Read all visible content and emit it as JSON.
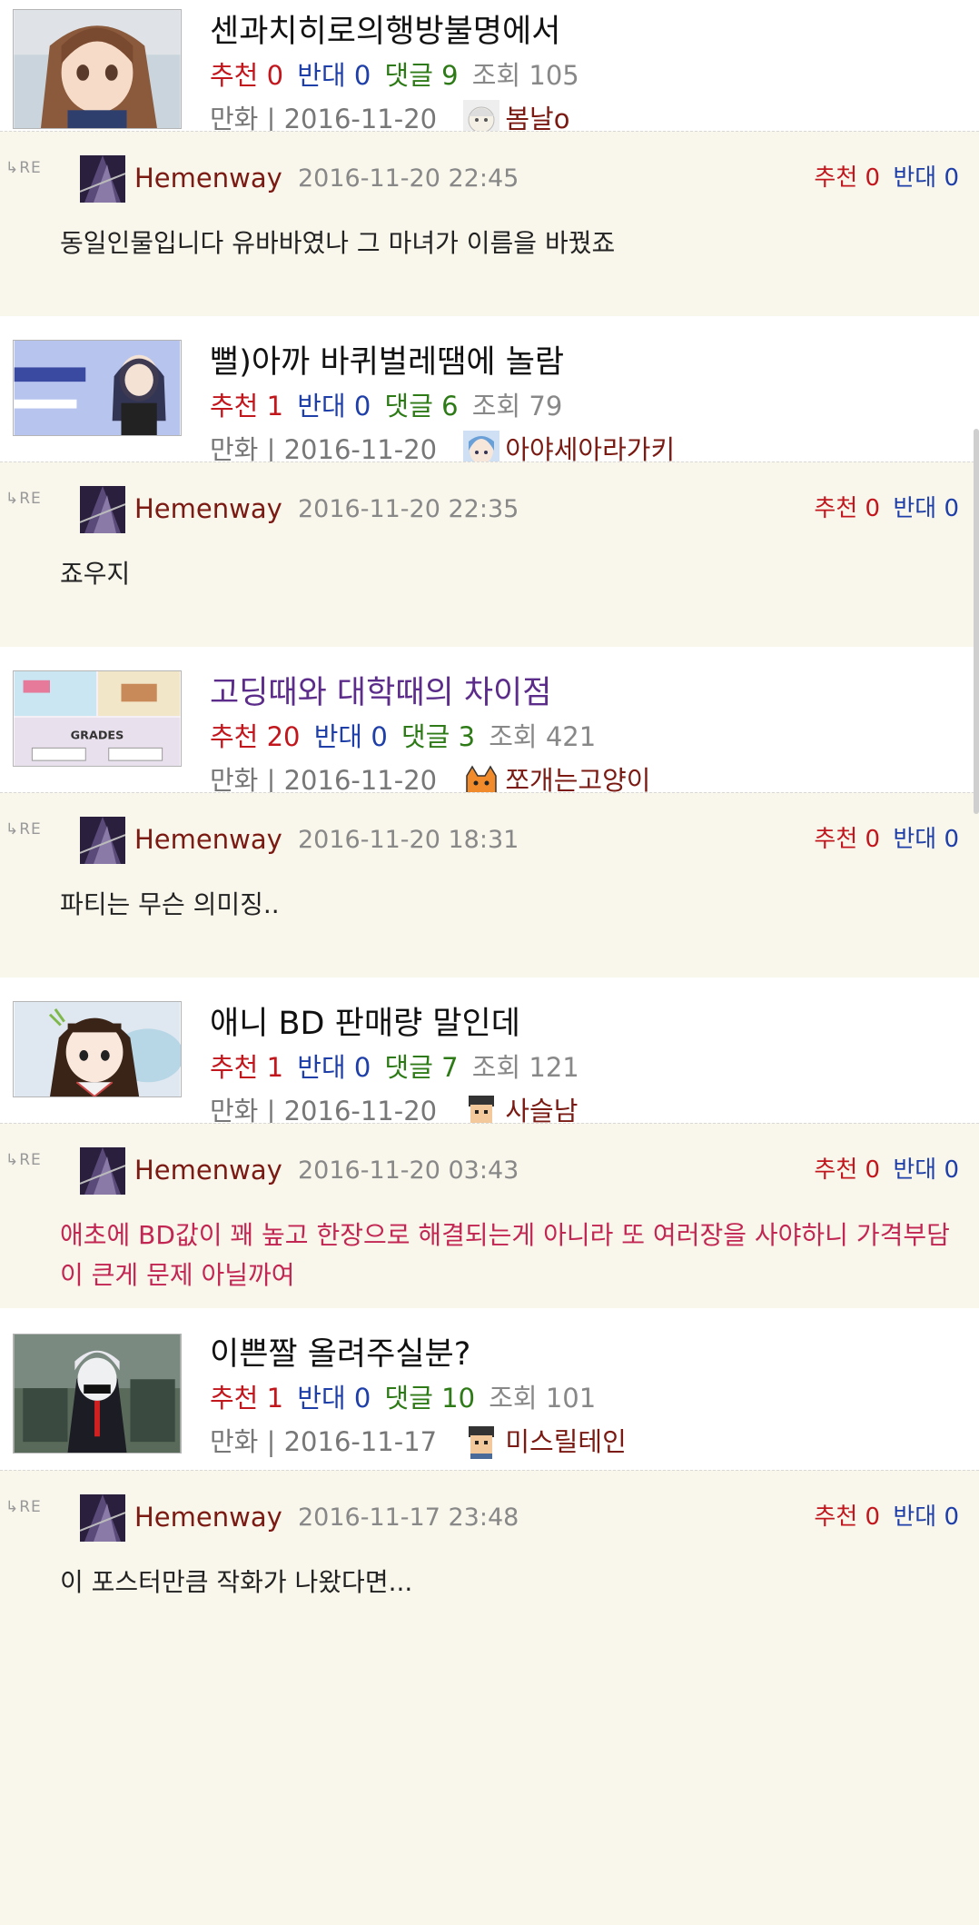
{
  "posts": [
    {
      "title": "센과치히로의행방불명에서",
      "stats": {
        "rec_label": "추천",
        "rec": "0",
        "opp_label": "반대",
        "opp": "0",
        "cmt_label": "댓글",
        "cmt": "9",
        "view_label": "조회",
        "view": "105"
      },
      "category": "만화",
      "separator": " | ",
      "date": "2016-11-20",
      "author": "봄날o",
      "reply": {
        "re": "RE",
        "author": "Hemenway",
        "datetime": "2016-11-20 22:45",
        "rec_label": "추천",
        "rec": "0",
        "opp_label": "반대",
        "opp": "0",
        "text": "동일인물입니다 유바바였나 그 마녀가 이름을 바꿨죠"
      }
    },
    {
      "title": "뻘)아까 바퀴벌레땜에 놀람",
      "stats": {
        "rec_label": "추천",
        "rec": "1",
        "opp_label": "반대",
        "opp": "0",
        "cmt_label": "댓글",
        "cmt": "6",
        "view_label": "조회",
        "view": "79"
      },
      "category": "만화",
      "separator": " | ",
      "date": "2016-11-20",
      "author": "아야세아라가키",
      "reply": {
        "re": "RE",
        "author": "Hemenway",
        "datetime": "2016-11-20 22:35",
        "rec_label": "추천",
        "rec": "0",
        "opp_label": "반대",
        "opp": "0",
        "text": "죠우지"
      }
    },
    {
      "title": "고딩때와 대학때의 차이점",
      "stats": {
        "rec_label": "추천",
        "rec": "20",
        "opp_label": "반대",
        "opp": "0",
        "cmt_label": "댓글",
        "cmt": "3",
        "view_label": "조회",
        "view": "421"
      },
      "category": "만화",
      "separator": " | ",
      "date": "2016-11-20",
      "author": "쪼개는고양이",
      "thumb_text": "GRADES",
      "reply": {
        "re": "RE",
        "author": "Hemenway",
        "datetime": "2016-11-20 18:31",
        "rec_label": "추천",
        "rec": "0",
        "opp_label": "반대",
        "opp": "0",
        "text": "파티는 무슨 의미징.."
      }
    },
    {
      "title": "애니 BD 판매량 말인데",
      "stats": {
        "rec_label": "추천",
        "rec": "1",
        "opp_label": "반대",
        "opp": "0",
        "cmt_label": "댓글",
        "cmt": "7",
        "view_label": "조회",
        "view": "121"
      },
      "category": "만화",
      "separator": " | ",
      "date": "2016-11-20",
      "author": "사슬남",
      "reply": {
        "re": "RE",
        "author": "Hemenway",
        "datetime": "2016-11-20 03:43",
        "rec_label": "추천",
        "rec": "0",
        "opp_label": "반대",
        "opp": "0",
        "text": "애초에 BD값이 꽤 높고 한장으로 해결되는게 아니라 또 여러장을 사야하니 가격부담이 큰게 문제 아닐까여"
      }
    },
    {
      "title": "이쁜짤 올려주실분?",
      "stats": {
        "rec_label": "추천",
        "rec": "1",
        "opp_label": "반대",
        "opp": "0",
        "cmt_label": "댓글",
        "cmt": "10",
        "view_label": "조회",
        "view": "101"
      },
      "category": "만화",
      "separator": " | ",
      "date": "2016-11-17",
      "author": "미스릴테인",
      "reply": {
        "re": "RE",
        "author": "Hemenway",
        "datetime": "2016-11-17 23:48",
        "rec_label": "추천",
        "rec": "0",
        "opp_label": "반대",
        "opp": "0",
        "text": "이 포스터만큼 작화가 나왔다면..."
      }
    }
  ],
  "colors": {
    "recommend": "#c2161d",
    "oppose": "#1f3fa8",
    "comment": "#2d7a17",
    "author": "#7a1a12",
    "reply_bg": "#f9f6ec",
    "visited_title": "#5b2c8a",
    "highlight_text": "#c22652"
  }
}
